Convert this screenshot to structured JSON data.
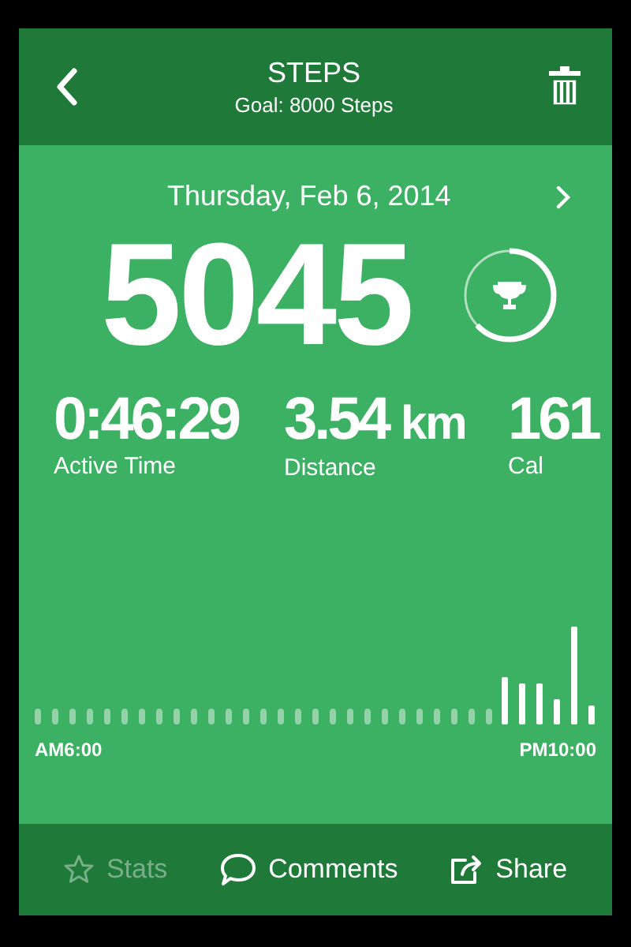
{
  "header": {
    "title": "STEPS",
    "subtitle": "Goal: 8000 Steps"
  },
  "date": "Thursday, Feb 6, 2014",
  "steps": {
    "value": "5045",
    "level": 0.63
  },
  "metrics": [
    {
      "value": "0:46:29",
      "label": "Active Time"
    },
    {
      "value": "3.54",
      "unit": "km",
      "label": "Distance"
    },
    {
      "value": "161",
      "label": "Cal"
    }
  ],
  "activity": {
    "start_label": "AM6:00",
    "end_label": "PM10:00"
  },
  "tabs": [
    {
      "kind": "stats",
      "label": "Stats",
      "disabled": true
    },
    {
      "kind": "comments",
      "label": "Comments",
      "disabled": false
    },
    {
      "kind": "share",
      "label": "Share",
      "disabled": false
    }
  ]
}
